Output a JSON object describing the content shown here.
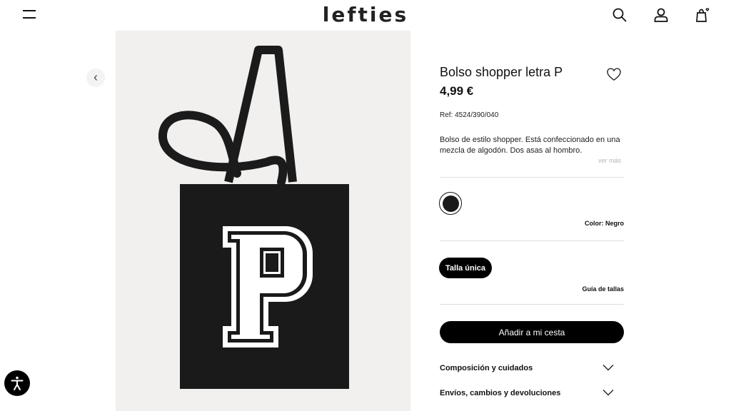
{
  "header": {
    "logo": "lefties",
    "menu_icon": "hamburger-menu-icon",
    "search_icon": "search-icon",
    "account_icon": "user-icon",
    "cart_icon": "shopping-bag-icon"
  },
  "gallery": {
    "prev_icon": "chevron-left-icon",
    "image_description": "bolso-shopper-negro-letra-p",
    "image_letter": "P"
  },
  "product": {
    "title": "Bolso shopper letra P",
    "price": "4,99 €",
    "ref": "Ref: 4524/390/040",
    "description": "Bolso de estilo shopper. Está confeccionado en una mezcla de algodón. Dos asas al hombro.",
    "see_more": "ver más",
    "favorite_icon": "heart-icon"
  },
  "color": {
    "label_prefix": "Color:",
    "label_value": "Negro",
    "swatch_hex": "#1a1a1a"
  },
  "size": {
    "selected": "Talla única",
    "guide": "Guía de tallas"
  },
  "cta": {
    "add_to_cart": "Añadir a mi cesta"
  },
  "accordions": [
    {
      "label": "Composición y cuidados"
    },
    {
      "label": "Envíos, cambios y devoluciones"
    }
  ],
  "accessibility": {
    "icon": "accessibility-icon"
  },
  "colors": {
    "brand": "#000000",
    "divider": "#dddddd",
    "image_bg": "#f1f0ee"
  }
}
